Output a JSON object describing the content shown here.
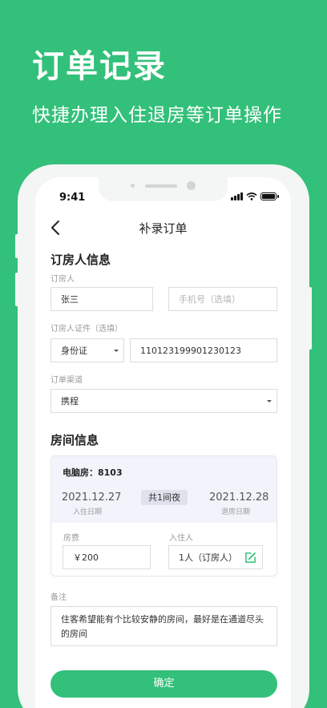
{
  "hero": {
    "title": "订单记录",
    "subtitle": "快捷办理入住退房等订单操作"
  },
  "status_bar": {
    "time": "9:41"
  },
  "nav": {
    "title": "补录订单",
    "back_icon": "chevron-left-icon"
  },
  "booker": {
    "section_title": "订房人信息",
    "name_label": "订房人",
    "name_value": "张三",
    "phone_placeholder": "手机号（选填）",
    "id_label": "订房人证件（选填）",
    "id_type": "身份证",
    "id_number": "110123199901230123",
    "channel_label": "订单渠道",
    "channel_value": "携程"
  },
  "room": {
    "section_title": "房间信息",
    "room_name": "电脑房：8103",
    "checkin_date": "2021.12.27",
    "checkin_label": "入住日期",
    "nights": "共1间夜",
    "checkout_date": "2021.12.28",
    "checkout_label": "退房日期",
    "fee_label": "房费",
    "fee_value": "￥200",
    "guests_label": "入住人",
    "guests_value": "1人（订房人）"
  },
  "remark": {
    "label": "备注",
    "text": "住客希望能有个比较安静的房间，最好是在通道尽头的房间"
  },
  "confirm_label": "确定",
  "colors": {
    "brand_green": "#33c07a",
    "card_bg": "#f2f4fb",
    "badge_bg": "#dfe2ec"
  }
}
